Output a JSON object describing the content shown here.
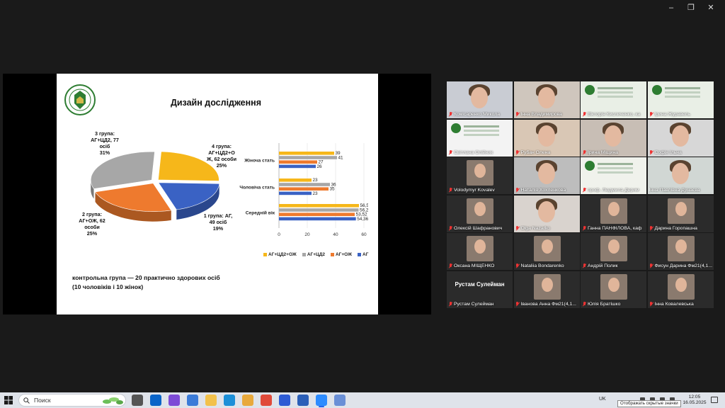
{
  "window": {
    "controls": {
      "minimize": "–",
      "maximize": "❐",
      "close": "✕"
    }
  },
  "slide": {
    "title": "Дизайн дослідження",
    "pie_labels": {
      "g3": [
        "3 група:",
        "АГ+ЦД2, 77",
        "осіб",
        "31%"
      ],
      "g4": [
        "4 група:",
        "АГ+ЦД2+О",
        "Ж, 62 особи",
        "25%"
      ],
      "g2": [
        "2 група:",
        "АГ+ОЖ, 62",
        "особи",
        "25%"
      ],
      "g1": [
        "1 група: АГ,",
        "49 осіб",
        "19%"
      ]
    },
    "control_text": [
      "контрольна група — 20 практично здорових осіб",
      "(10 чоловіків і 10 жінок)"
    ]
  },
  "chart_data": [
    {
      "type": "pie",
      "categories": [
        "1 група: АГ",
        "2 група: АГ+ОЖ",
        "3 група: АГ+ЦД2",
        "4 група: АГ+ЦД2+ОЖ"
      ],
      "values": [
        49,
        62,
        77,
        62
      ],
      "percents": [
        19,
        25,
        31,
        25
      ],
      "colors": [
        "#3a62c4",
        "#ee7a2e",
        "#a7a7a7",
        "#f6b71a"
      ]
    },
    {
      "type": "bar",
      "orientation": "horizontal",
      "categories": [
        "Жіноча стать",
        "Чоловіча стать",
        "Середній вік"
      ],
      "series": [
        {
          "name": "АГ+ЦД2+ОЖ",
          "color": "#f6b71a",
          "values": [
            39,
            23,
            56.5
          ]
        },
        {
          "name": "АГ+ЦД2",
          "color": "#a7a7a7",
          "values": [
            41,
            36,
            56.26
          ]
        },
        {
          "name": "АГ+ОЖ",
          "color": "#ee7a2e",
          "values": [
            27,
            35,
            53.52
          ]
        },
        {
          "name": "АГ",
          "color": "#3a62c4",
          "values": [
            26,
            23,
            54.36
          ]
        }
      ],
      "value_labels": [
        [
          "39",
          "41",
          "27",
          "26"
        ],
        [
          "23",
          "36",
          "35",
          "23"
        ],
        [
          "56,5",
          "56,26",
          "53,52",
          "54,36"
        ]
      ],
      "xticks": [
        "0",
        "20",
        "40",
        "60"
      ],
      "xlim": [
        0,
        60
      ],
      "legend_position": "bottom"
    }
  ],
  "participants": [
    {
      "name": "Комісаренко Микола",
      "video": "face",
      "bg": "#c9ccd3",
      "muted": true
    },
    {
      "name": "Інна Владимирова",
      "video": "face",
      "bg": "#cfc6bd",
      "muted": true
    },
    {
      "name": "Вікторія Кисличенко, ка",
      "video": "slide",
      "bg": "#e9efe6",
      "muted": true
    },
    {
      "name": "Ірина Журавель",
      "video": "slide",
      "bg": "#e9efe6",
      "muted": true
    },
    {
      "name": "Світлана Олійник",
      "video": "slide",
      "bg": "#f3f3f3",
      "muted": true
    },
    {
      "name": "Рубан Олена",
      "video": "face",
      "bg": "#d9c7b5",
      "muted": true
    },
    {
      "name": "Ірина Міщина",
      "video": "face",
      "bg": "#c8beb5",
      "muted": true
    },
    {
      "name": "Софія Ільна",
      "video": "face",
      "bg": "#d7d7d7",
      "muted": true
    },
    {
      "name": "Volodymyr Kovalev",
      "video": "avatar",
      "bg": "#2b2b2b",
      "muted": true
    },
    {
      "name": "Наталія Хохленкова",
      "video": "face",
      "bg": "#bdbdbd",
      "muted": true
    },
    {
      "name": "проф. Людмила Дерим",
      "video": "slide",
      "bg": "#f0f2ec",
      "muted": true
    },
    {
      "name": "Інна Павлівна Дунаєва",
      "video": "face",
      "bg": "#d1d7d4",
      "muted": false,
      "highlight": true
    },
    {
      "name": "Олексій Шафранович",
      "video": "avatar",
      "bg": "#2b2b2b",
      "muted": true
    },
    {
      "name": "Olga Nazarko",
      "video": "face",
      "bg": "#d9d3ce",
      "muted": true
    },
    {
      "name": "Ганна ПАНФІЛОВА, каф",
      "video": "avatar",
      "bg": "#2b2b2b",
      "muted": true
    },
    {
      "name": "Дарина Горопашна",
      "video": "avatar",
      "bg": "#2b2b2b",
      "muted": true
    },
    {
      "name": "Оксана МІЩЕНКО",
      "video": "avatar",
      "bg": "#2b2b2b",
      "muted": true
    },
    {
      "name": "Nataliia Bondarenko",
      "video": "avatar",
      "bg": "#2b2b2b",
      "muted": true
    },
    {
      "name": "Андрій Полик",
      "video": "avatar",
      "bg": "#2b2b2b",
      "muted": true
    },
    {
      "name": "Фисун Дарина Фм21(4,1...",
      "video": "avatar",
      "bg": "#2b2b2b",
      "muted": true
    },
    {
      "name": "Рустам Сулейман",
      "video": "name",
      "bg": "#2b2b2b",
      "muted": true,
      "big_name": "Рустам Сулейман"
    },
    {
      "name": "Іванова Анна Фм21(4,1...",
      "video": "avatar",
      "bg": "#2b2b2b",
      "muted": true
    },
    {
      "name": "Юлія Братішко",
      "video": "avatar",
      "bg": "#2b2b2b",
      "muted": true
    },
    {
      "name": "Інна Ковалевська",
      "video": "avatar",
      "bg": "#2b2b2b",
      "muted": true
    }
  ],
  "taskbar": {
    "search_placeholder": "Поиск",
    "lang": "UK",
    "time": "12:05",
    "date": "16.05.2025",
    "tooltip": "Отображать скрытые значки",
    "apps": [
      "task-view",
      "outlook",
      "copilot",
      "store",
      "file-explorer",
      "edge",
      "files",
      "chrome",
      "mail-app",
      "word",
      "zoom",
      "paint"
    ]
  }
}
